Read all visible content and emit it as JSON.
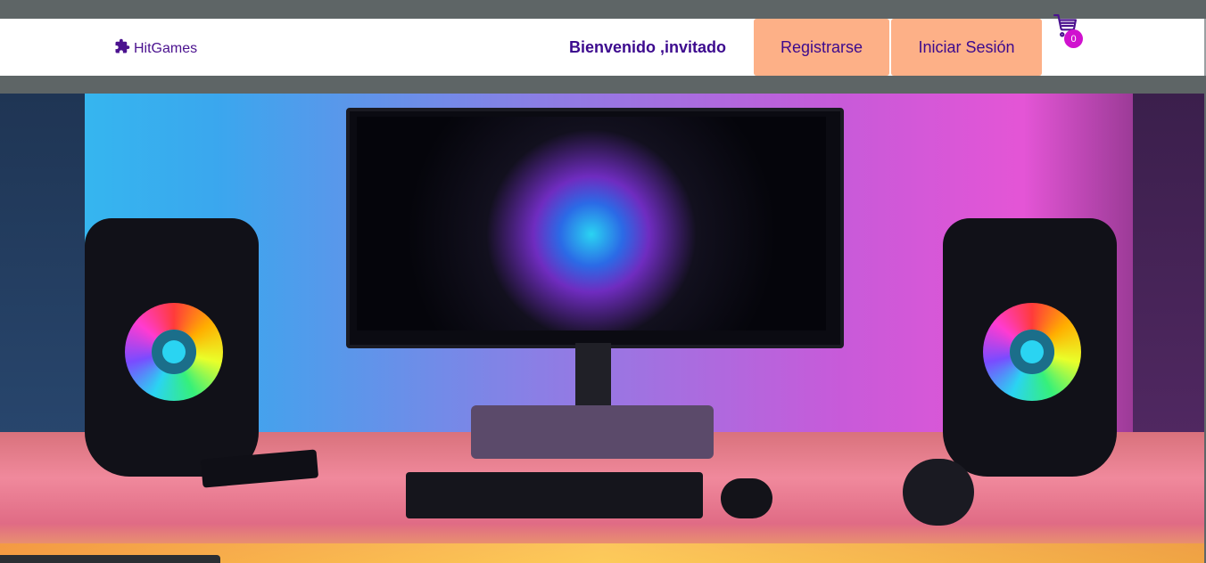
{
  "navbar": {
    "brand": "HitGames",
    "welcome": "Bienvenido ,invitado",
    "register_label": "Registrarse",
    "login_label": "Iniciar Sesión",
    "cart_count": "0"
  },
  "icons": {
    "brand_icon": "puzzle-icon",
    "cart_icon": "cart-icon"
  },
  "colors": {
    "nav_text": "#3c0a8e",
    "button_bg": "#fdb087",
    "badge_bg": "#d011cf"
  },
  "hero": {
    "image": "gaming-setup-photo"
  }
}
